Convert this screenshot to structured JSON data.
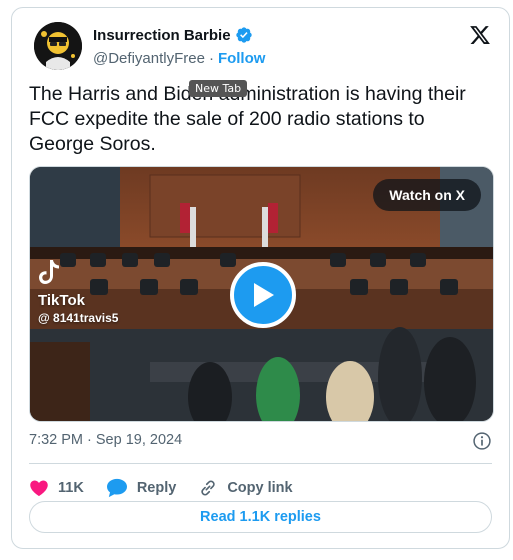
{
  "author": {
    "name": "Insurrection Barbie",
    "handle": "@DefiyantlyFree",
    "separator": "·",
    "follow_label": "Follow"
  },
  "tooltip": "New Tab",
  "tweet": {
    "text": "The Harris and Biden administration is having their FCC expedite the sale of 200 radio stations to George Soros."
  },
  "media": {
    "watch_label": "Watch on X",
    "tiktok_word": "TikTok",
    "tiktok_handle": "@ 8141travis5"
  },
  "meta": {
    "timestamp": "7:32 PM · Sep 19, 2024"
  },
  "actions": {
    "likes": "11K",
    "reply_label": "Reply",
    "copy_label": "Copy link"
  },
  "read_replies": "Read 1.1K replies",
  "colors": {
    "accent": "#1d9bf0",
    "heart": "#f91880",
    "muted": "#536471",
    "text": "#0f1419",
    "border": "#cfd9de"
  },
  "icons": [
    "verified-badge-icon",
    "x-logo-icon",
    "play-icon",
    "tiktok-icon",
    "info-icon",
    "heart-icon",
    "reply-bubble-icon",
    "link-icon"
  ]
}
